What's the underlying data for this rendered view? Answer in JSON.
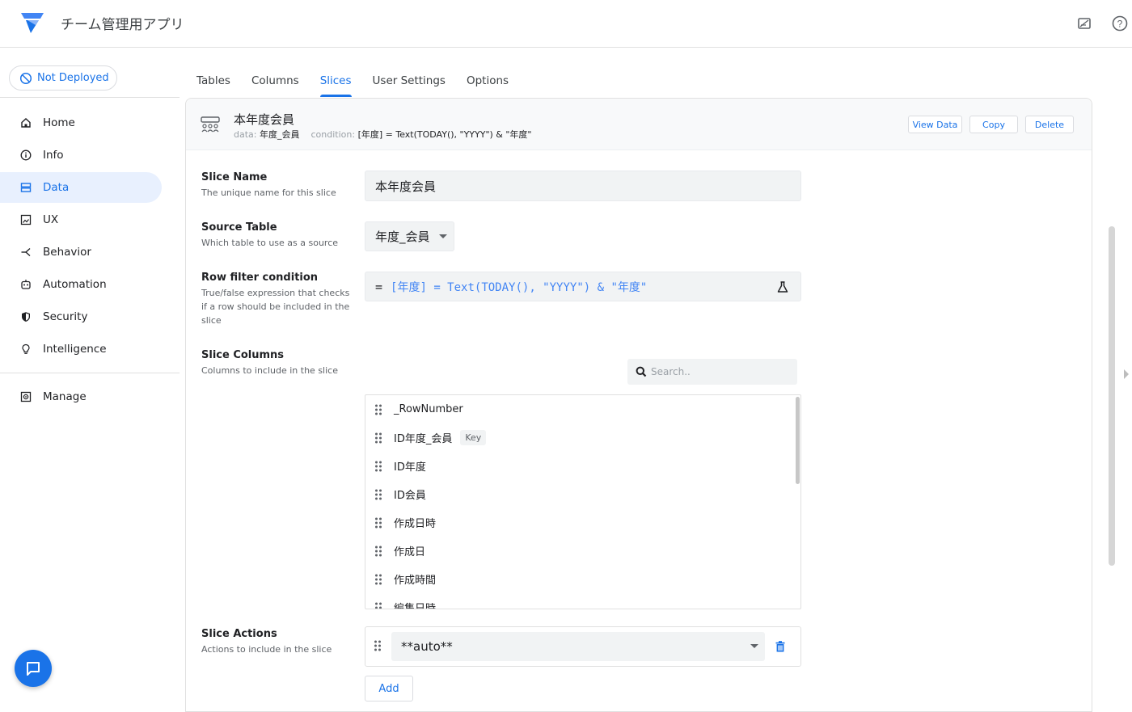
{
  "app": {
    "title": "チーム管理用アプリ"
  },
  "deploy": {
    "label": "Not Deployed"
  },
  "tabs": [
    {
      "label": "Tables"
    },
    {
      "label": "Columns"
    },
    {
      "label": "Slices",
      "active": true
    },
    {
      "label": "User Settings"
    },
    {
      "label": "Options"
    }
  ],
  "sidebar": {
    "items": [
      {
        "label": "Home",
        "icon": "home-icon"
      },
      {
        "label": "Info",
        "icon": "info-icon"
      },
      {
        "label": "Data",
        "icon": "data-icon",
        "active": true
      },
      {
        "label": "UX",
        "icon": "ux-icon"
      },
      {
        "label": "Behavior",
        "icon": "behavior-icon"
      },
      {
        "label": "Automation",
        "icon": "automation-icon"
      },
      {
        "label": "Security",
        "icon": "security-icon"
      },
      {
        "label": "Intelligence",
        "icon": "lightbulb-icon"
      }
    ],
    "manage": {
      "label": "Manage",
      "icon": "manage-icon"
    }
  },
  "slice": {
    "title": "本年度会員",
    "meta_data_label": "data:",
    "meta_data_value": "年度_会員",
    "meta_condition_label": "condition:",
    "meta_condition_value": "[年度] = Text(TODAY(), \"YYYY\") & \"年度\"",
    "buttons": {
      "view_data": "View Data",
      "copy": "Copy",
      "delete": "Delete"
    }
  },
  "form": {
    "name": {
      "label": "Slice Name",
      "help": "The unique name for this slice",
      "value": "本年度会員"
    },
    "source": {
      "label": "Source Table",
      "help": "Which table to use as a source",
      "value": "年度_会員"
    },
    "filter": {
      "label": "Row filter condition",
      "help": "True/false expression that checks if a row should be included in the slice",
      "eq": "=",
      "value": "[年度] = Text(TODAY(), \"YYYY\") & \"年度\""
    },
    "columns": {
      "label": "Slice Columns",
      "help": "Columns to include in the slice",
      "search_placeholder": "Search..",
      "items": [
        {
          "name": "_RowNumber"
        },
        {
          "name": "ID年度_会員",
          "badge": "Key"
        },
        {
          "name": "ID年度"
        },
        {
          "name": "ID会員"
        },
        {
          "name": "作成日時"
        },
        {
          "name": "作成日"
        },
        {
          "name": "作成時間"
        },
        {
          "name": "編集日時"
        }
      ]
    },
    "actions": {
      "label": "Slice Actions",
      "help": "Actions to include in the slice",
      "value": "**auto**",
      "add_label": "Add"
    }
  },
  "colors": {
    "accent": "#1a73e8",
    "active_bg": "#e8f0fe"
  }
}
